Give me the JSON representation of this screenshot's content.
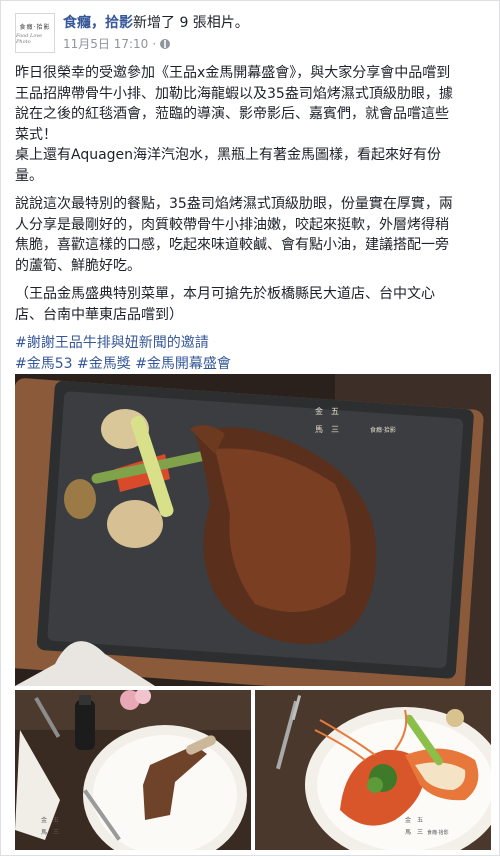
{
  "header": {
    "page_name": "食癮，拾影",
    "action_text": "新增了 9 張相片。",
    "timestamp": "11月5日 17:10",
    "dot": "·",
    "avatar_line1": "食癮·拾影",
    "avatar_line2": "Food Love Photo"
  },
  "post": {
    "paragraph1": [
      "昨日很榮幸的受邀參加《王品x金馬開幕盛會》，與大家分享會中品嚐到",
      "王品招牌帶骨牛小排、加勒比海龍蝦以及35盎司焰烤濕式頂級肋眼，據",
      "說在之後的紅毯酒會，蒞臨的導演、影帝影后、嘉賓們，就會品嚐這些",
      "菜式！",
      "桌上還有Aquagen海洋汽泡水，黑瓶上有著金馬圖樣，看起來好有份",
      "量。"
    ],
    "paragraph2": [
      "說說這次最特別的餐點，35盎司焰烤濕式頂級肋眼，份量實在厚實，兩",
      "人分享是最剛好的，肉質較帶骨牛小排油嫩，咬起來挺軟，外層烤得稍",
      "焦脆，喜歡這樣的口感，吃起來味道較鹹、會有點小油，建議搭配一旁",
      "的蘆筍、鮮脆好吃。"
    ],
    "paragraph3": [
      "（王品金馬盛典特別菜單，本月可搶先於板橋縣民大道店、台中文心",
      "店、台南中華東店品嚐到）"
    ],
    "hashtag1": "#謝謝王品牛排與妞新聞的邀請",
    "hashtags2": [
      "#金馬53",
      "#金馬獎",
      "#金馬開幕盛會"
    ]
  },
  "photos": {
    "main_watermark_line1": "金　五",
    "main_watermark_line2": "馬　三",
    "main_watermark_brand": "食癮·拾影",
    "small_watermark_line1": "金　五",
    "small_watermark_line2": "馬　三",
    "small_watermark_brand": "食癮·拾影"
  },
  "colors": {
    "link": "#365899",
    "meta": "#90949c",
    "text": "#1d2129"
  }
}
